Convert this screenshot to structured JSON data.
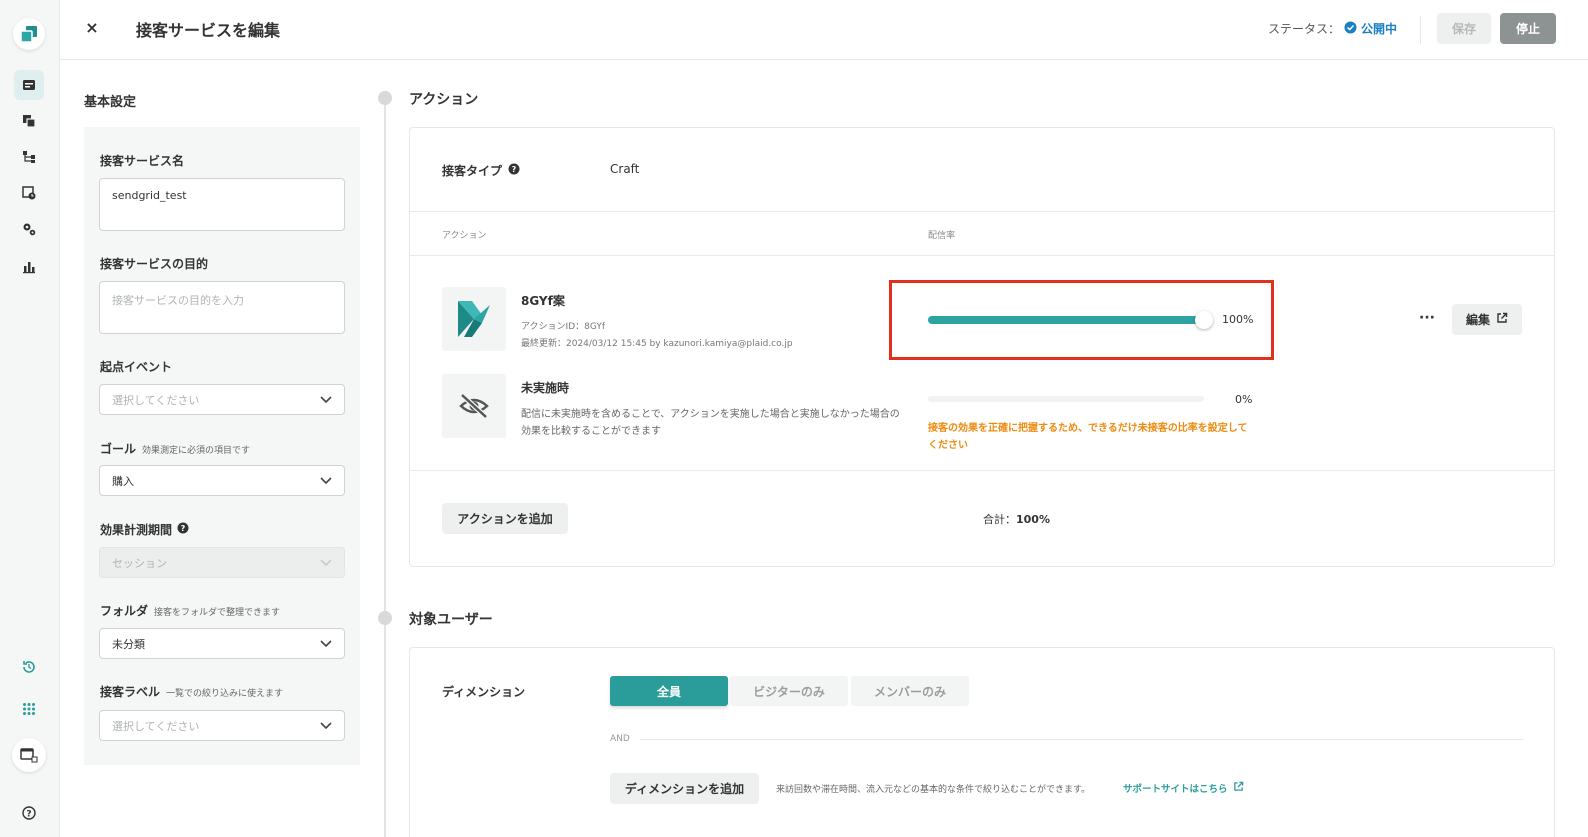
{
  "header": {
    "close_label": "×",
    "title": "接客サービスを編集",
    "status_label": "ステータス：",
    "status_value": "公開中",
    "save_label": "保存",
    "stop_label": "停止"
  },
  "sidebar": {
    "items": [
      {
        "icon": "campaign-icon",
        "active": true
      },
      {
        "icon": "copy-icon"
      },
      {
        "icon": "flow-icon"
      },
      {
        "icon": "schedule-icon"
      },
      {
        "icon": "settings-icon"
      },
      {
        "icon": "chart-icon"
      }
    ],
    "bottom": [
      {
        "icon": "history-icon"
      },
      {
        "icon": "apps-grid-icon"
      },
      {
        "icon": "preview-window-icon"
      },
      {
        "icon": "help-icon"
      }
    ]
  },
  "settings": {
    "title": "基本設定",
    "name_label": "接客サービス名",
    "name_value": "sendgrid_test",
    "purpose_label": "接客サービスの目的",
    "purpose_placeholder": "接客サービスの目的を入力",
    "event_label": "起点イベント",
    "event_placeholder": "選択してください",
    "goal_label": "ゴール",
    "goal_sub": "効果測定に必須の項目です",
    "goal_value": "購入",
    "period_label": "効果計測期間",
    "period_value": "セッション",
    "folder_label": "フォルダ",
    "folder_sub": "接客をフォルダで整理できます",
    "folder_value": "未分類",
    "tag_label": "接客ラベル",
    "tag_sub": "一覧での絞り込みに使えます",
    "tag_placeholder": "選択してください"
  },
  "action_section": {
    "title": "アクション",
    "type_label": "接客タイプ",
    "type_value": "Craft",
    "col_action": "アクション",
    "col_rate": "配信率",
    "action": {
      "name": "8GYf案",
      "id_line": "アクションID：8GYf",
      "updated_line": "最終更新：2024/03/12 15:45 by kazunori.kamiya@plaid.co.jp",
      "rate_label": "100%",
      "rate": 1.0,
      "more_label": "···",
      "edit_label": "編集"
    },
    "control": {
      "name": "未実施時",
      "desc_line1": "配信に未実施時を含めることで、アクションを実施した場合と実施しなかった場合の",
      "desc_line2": "効果を比較することができます",
      "rate_label": "0%",
      "rate": 0.0,
      "warning_line1": "接客の効果を正確に把握するため、できるだけ未接客の比率を設定して",
      "warning_line2": "ください"
    },
    "add_action_label": "アクションを追加",
    "total_label": "合計：",
    "total_value": "100%"
  },
  "target_section": {
    "title": "対象ユーザー",
    "dimension_label": "ディメンション",
    "segments": [
      "全員",
      "ビジターのみ",
      "メンバーのみ"
    ],
    "and_label": "AND",
    "add_dimension_label": "ディメンションを追加",
    "hint": "来訪回数や滞在時間、流入元などの基本的な条件で絞り込むことができます。",
    "support_link": "サポートサイトはこちら"
  },
  "colors": {
    "accent": "#2a9d9b",
    "status_blue": "#1c7fc4",
    "warning": "#ee8b10",
    "highlight": "#e0301e"
  }
}
